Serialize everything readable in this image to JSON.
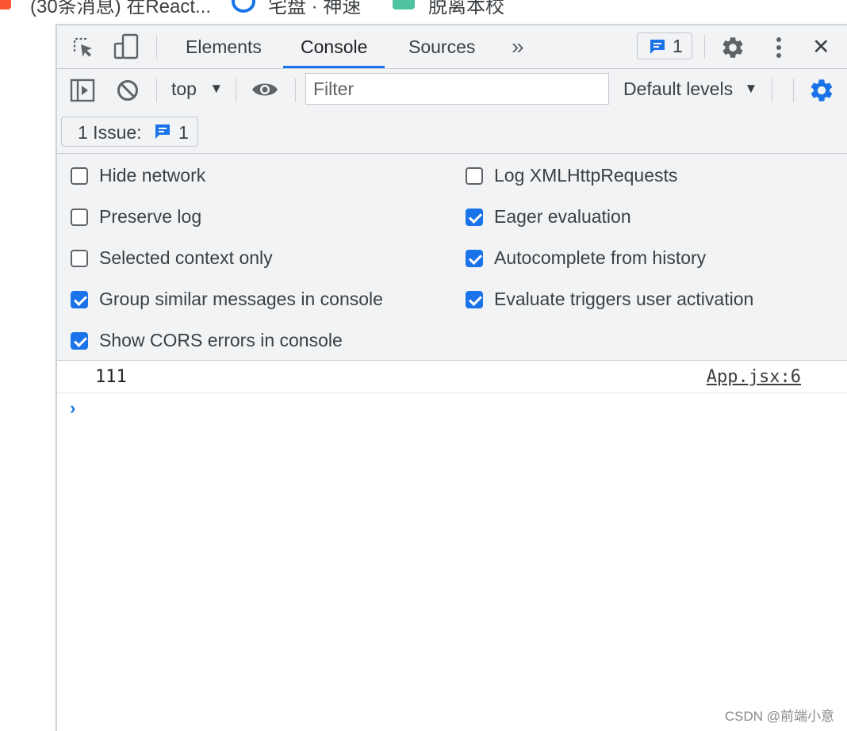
{
  "bookmarks": [
    {
      "label": "(30条消息) 在React...",
      "icon": "csdn-icon",
      "color": "#fc5531"
    },
    {
      "label": "宅盘 · 神速",
      "icon": "chrome-icon",
      "color": "#1a73e8"
    },
    {
      "label": "脱离本校",
      "icon": "bookmark-app-icon",
      "color": "#4fc3a1"
    }
  ],
  "devtools": {
    "tabs": [
      "Elements",
      "Console",
      "Sources"
    ],
    "active_tab": "Console",
    "more_tabs_glyph": "»",
    "issue_badge_count": "1",
    "close_glyph": "✕"
  },
  "console_toolbar": {
    "context": "top",
    "filter_placeholder": "Filter",
    "levels": "Default levels",
    "dropdown_glyph": "▼"
  },
  "issues": {
    "label": "1 Issue:",
    "count": "1"
  },
  "settings": {
    "left": [
      {
        "label": "Hide network",
        "checked": false
      },
      {
        "label": "Preserve log",
        "checked": false
      },
      {
        "label": "Selected context only",
        "checked": false
      },
      {
        "label": "Group similar messages in console",
        "checked": true
      },
      {
        "label": "Show CORS errors in console",
        "checked": true
      }
    ],
    "right": [
      {
        "label": "Log XMLHttpRequests",
        "checked": false
      },
      {
        "label": "Eager evaluation",
        "checked": true
      },
      {
        "label": "Autocomplete from history",
        "checked": true
      },
      {
        "label": "Evaluate triggers user activation",
        "checked": true
      }
    ]
  },
  "log": {
    "message": "111",
    "source": "App.jsx:6"
  },
  "prompt_glyph": "›",
  "watermark": "CSDN @前端小意",
  "colors": {
    "accent": "#1a73e8",
    "toolbar_bg": "#f1f3f4",
    "icon_gray": "#5f6368"
  }
}
